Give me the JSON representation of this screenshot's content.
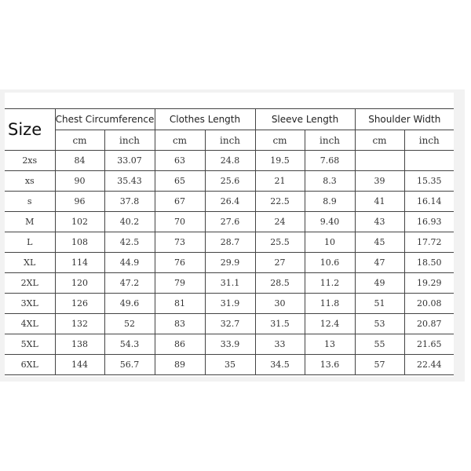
{
  "table": {
    "size_label": "Size",
    "groups": [
      "Chest Circumference",
      "Clothes Length",
      "Sleeve Length",
      "Shoulder Width"
    ],
    "units": [
      "cm",
      "inch",
      "cm",
      "inch",
      "cm",
      "inch",
      "cm",
      "inch"
    ],
    "rows": [
      [
        "2xs",
        "84",
        "33.07",
        "63",
        "24.8",
        "19.5",
        "7.68",
        "",
        ""
      ],
      [
        "xs",
        "90",
        "35.43",
        "65",
        "25.6",
        "21",
        "8.3",
        "39",
        "15.35"
      ],
      [
        "s",
        "96",
        "37.8",
        "67",
        "26.4",
        "22.5",
        "8.9",
        "41",
        "16.14"
      ],
      [
        "M",
        "102",
        "40.2",
        "70",
        "27.6",
        "24",
        "9.40",
        "43",
        "16.93"
      ],
      [
        "L",
        "108",
        "42.5",
        "73",
        "28.7",
        "25.5",
        "10",
        "45",
        "17.72"
      ],
      [
        "XL",
        "114",
        "44.9",
        "76",
        "29.9",
        "27",
        "10.6",
        "47",
        "18.50"
      ],
      [
        "2XL",
        "120",
        "47.2",
        "79",
        "31.1",
        "28.5",
        "11.2",
        "49",
        "19.29"
      ],
      [
        "3XL",
        "126",
        "49.6",
        "81",
        "31.9",
        "30",
        "11.8",
        "51",
        "20.08"
      ],
      [
        "4XL",
        "132",
        "52",
        "83",
        "32.7",
        "31.5",
        "12.4",
        "53",
        "20.87"
      ],
      [
        "5XL",
        "138",
        "54.3",
        "86",
        "33.9",
        "33",
        "13",
        "55",
        "21.65"
      ],
      [
        "6XL",
        "144",
        "56.7",
        "89",
        "35",
        "34.5",
        "13.6",
        "57",
        "22.44"
      ]
    ]
  }
}
